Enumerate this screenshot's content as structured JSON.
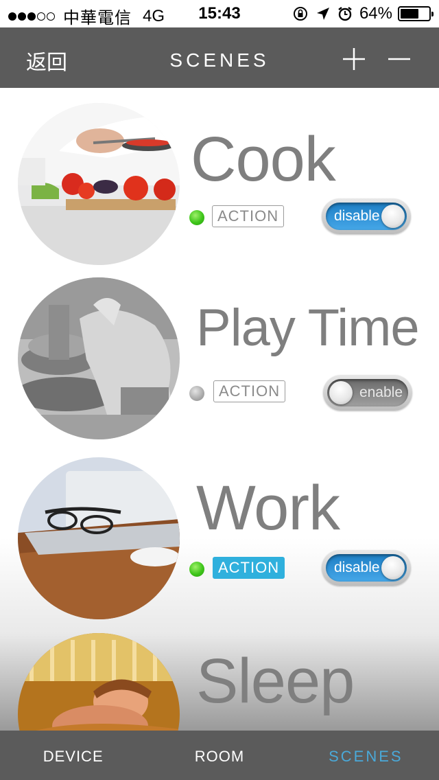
{
  "status_bar": {
    "carrier": "中華電信",
    "network": "4G",
    "time": "15:43",
    "battery": "64%",
    "battery_level": 0.64,
    "icons": [
      "signal-dots-icon",
      "rotation-lock-icon",
      "location-arrow-icon",
      "alarm-icon",
      "battery-icon"
    ]
  },
  "nav": {
    "back_label": "返回",
    "title": "SCENES",
    "add_icon": "plus-icon",
    "remove_icon": "minus-icon"
  },
  "scenes": [
    {
      "name": "Cook",
      "status_led": "on",
      "action_label": "ACTION",
      "action_style": "outline",
      "toggle_label": "disable"
    },
    {
      "name": "Play Time",
      "status_led": "off",
      "action_label": "ACTION",
      "action_style": "outline",
      "toggle_label": "enable"
    },
    {
      "name": "Work",
      "status_led": "on",
      "action_label": "ACTION",
      "action_style": "active",
      "toggle_label": "disable"
    },
    {
      "name": "Sleep"
    }
  ],
  "tabs": [
    {
      "label": "DEVICE",
      "selected": false
    },
    {
      "label": "ROOM",
      "selected": false
    },
    {
      "label": "SCENES",
      "selected": true
    }
  ],
  "colors": {
    "bar_bg": "#5b5b5b",
    "accent_blue": "#2fb0dd",
    "selected_tab": "#4aa9d9",
    "led_on": "#3ec51a",
    "scene_name": "#7f7f7f"
  }
}
